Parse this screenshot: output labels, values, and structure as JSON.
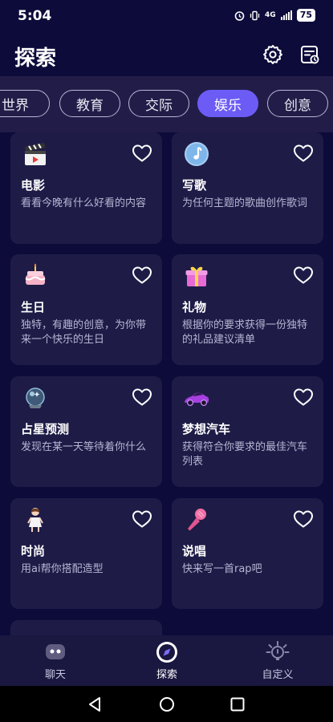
{
  "status_bar": {
    "time": "5:04",
    "network": "4G",
    "battery": "75"
  },
  "header": {
    "title": "探索",
    "icons": [
      "settings-gear-icon",
      "history-list-icon"
    ]
  },
  "tabs": [
    {
      "label": "世界",
      "active": false
    },
    {
      "label": "教育",
      "active": false
    },
    {
      "label": "交际",
      "active": false
    },
    {
      "label": "娱乐",
      "active": true
    },
    {
      "label": "创意",
      "active": false
    }
  ],
  "cards": [
    {
      "title": "电影",
      "desc": "看看今晚有什么好看的内容",
      "icon": "clapperboard-icon"
    },
    {
      "title": "写歌",
      "desc": "为任何主题的歌曲创作歌词",
      "icon": "music-note-icon"
    },
    {
      "title": "生日",
      "desc": "独特，有趣的创意，为你带来一个快乐的生日",
      "icon": "birthday-cake-icon"
    },
    {
      "title": "礼物",
      "desc": "根据你的要求获得一份独特的礼品建议清单",
      "icon": "gift-box-icon"
    },
    {
      "title": "占星预测",
      "desc": "发现在某一天等待着你什么",
      "icon": "crystal-ball-icon"
    },
    {
      "title": "梦想汽车",
      "desc": "获得符合你要求的最佳汽车列表",
      "icon": "sports-car-icon"
    },
    {
      "title": "时尚",
      "desc": "用ai帮你搭配造型",
      "icon": "fashion-girl-icon"
    },
    {
      "title": "说唱",
      "desc": "快来写一首rap吧",
      "icon": "microphone-icon"
    }
  ],
  "bottom_nav": [
    {
      "label": "聊天",
      "icon": "robot-chat-icon",
      "active": false
    },
    {
      "label": "探索",
      "icon": "compass-icon",
      "active": true
    },
    {
      "label": "自定义",
      "icon": "lightbulb-icon",
      "active": false
    }
  ],
  "colors": {
    "background": "#0d0b3a",
    "card": "#1e1c47",
    "accent": "#6c5cf5",
    "tab_bar": "#221d48"
  }
}
